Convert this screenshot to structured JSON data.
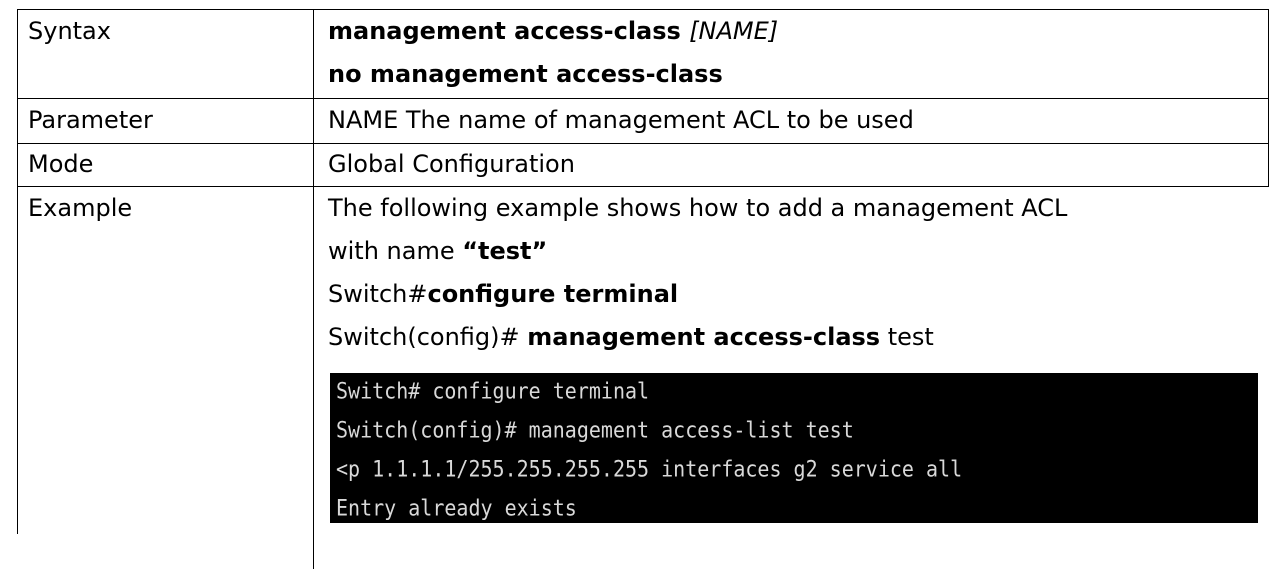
{
  "rows": {
    "syntax": {
      "label": "Syntax",
      "command": "management access-class",
      "param_placeholder": "[NAME]",
      "no_command": "no management access-class"
    },
    "parameter": {
      "label": "Parameter",
      "text": "NAME The name of management ACL to be used"
    },
    "mode": {
      "label": "Mode",
      "text": "Global Configuration"
    },
    "example": {
      "label": "Example",
      "desc_line1": "The following example shows how to add a management ACL",
      "desc_line2_prefix": "with name ",
      "desc_line2_bold": "“test”",
      "cmd1_prefix": "Switch#",
      "cmd1_bold": "configure terminal",
      "cmd2_prefix": "Switch(config)# ",
      "cmd2_bold": "management access-class",
      "cmd2_suffix": " test"
    }
  },
  "terminal": {
    "lines": [
      "Switch# configure terminal",
      "Switch(config)# management access-list test",
      "<p 1.1.1.1/255.255.255.255 interfaces g2 service all",
      "Entry already exists"
    ]
  }
}
